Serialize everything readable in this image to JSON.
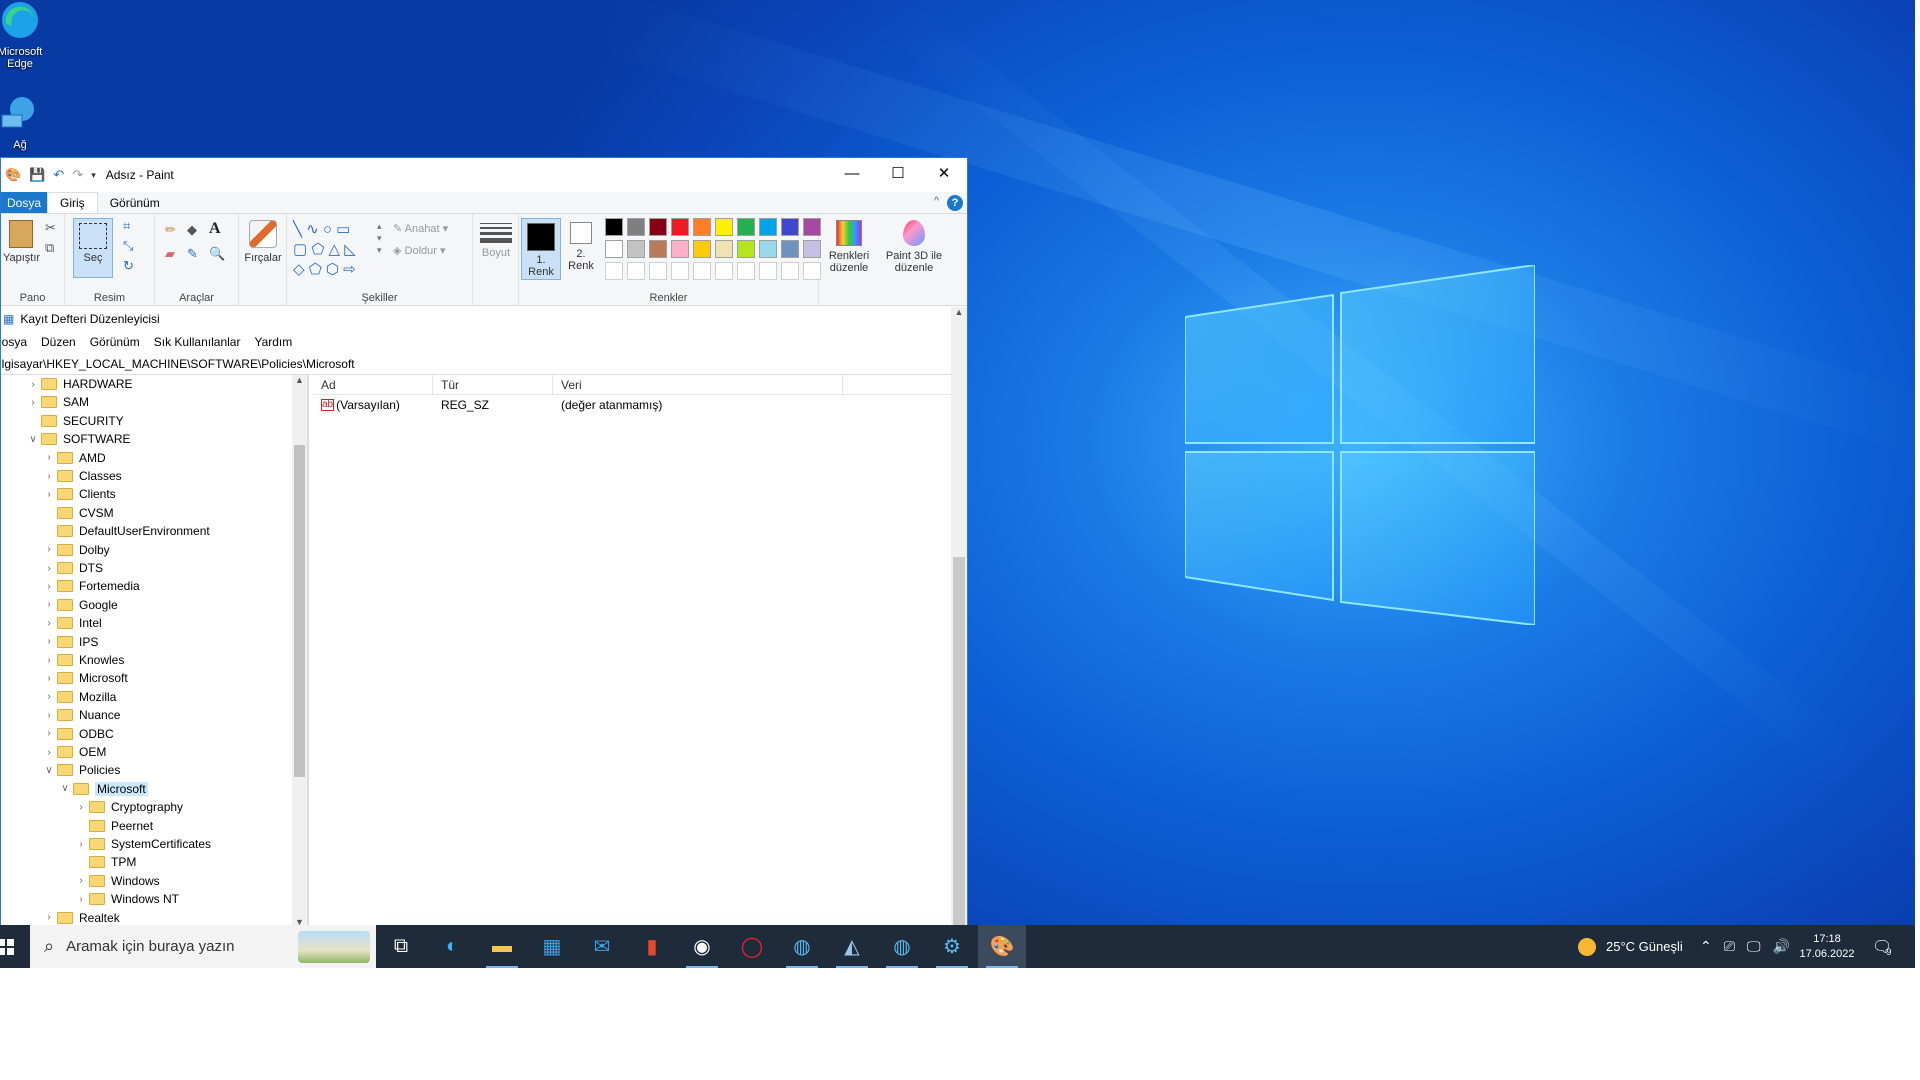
{
  "desktop": {
    "icons": [
      {
        "label": "Microsoft Edge"
      },
      {
        "label": "Ağ"
      }
    ]
  },
  "paint": {
    "title": "Adsız - Paint",
    "tabs": {
      "file": "Dosya",
      "home": "Giriş",
      "view": "Görünüm"
    },
    "groups": {
      "clipboard": "Pano",
      "image": "Resim",
      "tools": "Araçlar",
      "shapes": "Şekiller",
      "colors": "Renkler"
    },
    "buttons": {
      "paste": "Yapıştır",
      "select": "Seç",
      "brushes": "Fırçalar",
      "outline": "Anahat",
      "fill": "Doldur",
      "size": "Boyut",
      "color1_line1": "1.",
      "color1_line2": "Renk",
      "color2_line1": "2.",
      "color2_line2": "Renk",
      "edit_colors_line1": "Renkleri",
      "edit_colors_line2": "düzenle",
      "paint3d_line1": "Paint 3D ile",
      "paint3d_line2": "düzenle"
    },
    "palette_row1": [
      "#000000",
      "#7f7f7f",
      "#880015",
      "#ed1c24",
      "#ff7f27",
      "#fff200",
      "#22b14c",
      "#00a2e8",
      "#3f48cc",
      "#a349a4"
    ],
    "palette_row2": [
      "#ffffff",
      "#c3c3c3",
      "#b97a57",
      "#ffaec9",
      "#ffc90e",
      "#efe4b0",
      "#b5e61d",
      "#99d9ea",
      "#7092be",
      "#c8bfe7"
    ]
  },
  "regedit": {
    "title": "Kayıt Defteri Düzenleyicisi",
    "menu": [
      "Dosya",
      "Düzen",
      "Görünüm",
      "Sık Kullanılanlar",
      "Yardım"
    ],
    "address": "Bilgisayar\\HKEY_LOCAL_MACHINE\\SOFTWARE\\Policies\\Microsoft",
    "tree": [
      {
        "label": "HARDWARE",
        "depth": 0,
        "expanded": false
      },
      {
        "label": "SAM",
        "depth": 0,
        "expanded": false
      },
      {
        "label": "SECURITY",
        "depth": 0,
        "expanded": null
      },
      {
        "label": "SOFTWARE",
        "depth": 0,
        "expanded": true
      },
      {
        "label": "AMD",
        "depth": 1,
        "expanded": false
      },
      {
        "label": "Classes",
        "depth": 1,
        "expanded": false
      },
      {
        "label": "Clients",
        "depth": 1,
        "expanded": false
      },
      {
        "label": "CVSM",
        "depth": 1,
        "expanded": null
      },
      {
        "label": "DefaultUserEnvironment",
        "depth": 1,
        "expanded": null
      },
      {
        "label": "Dolby",
        "depth": 1,
        "expanded": false
      },
      {
        "label": "DTS",
        "depth": 1,
        "expanded": false
      },
      {
        "label": "Fortemedia",
        "depth": 1,
        "expanded": false
      },
      {
        "label": "Google",
        "depth": 1,
        "expanded": false
      },
      {
        "label": "Intel",
        "depth": 1,
        "expanded": false
      },
      {
        "label": "IPS",
        "depth": 1,
        "expanded": false
      },
      {
        "label": "Knowles",
        "depth": 1,
        "expanded": false
      },
      {
        "label": "Microsoft",
        "depth": 1,
        "expanded": false
      },
      {
        "label": "Mozilla",
        "depth": 1,
        "expanded": false
      },
      {
        "label": "Nuance",
        "depth": 1,
        "expanded": false
      },
      {
        "label": "ODBC",
        "depth": 1,
        "expanded": false
      },
      {
        "label": "OEM",
        "depth": 1,
        "expanded": false
      },
      {
        "label": "Policies",
        "depth": 1,
        "expanded": true
      },
      {
        "label": "Microsoft",
        "depth": 2,
        "expanded": true,
        "selected": true
      },
      {
        "label": "Cryptography",
        "depth": 3,
        "expanded": false
      },
      {
        "label": "Peernet",
        "depth": 3,
        "expanded": null
      },
      {
        "label": "SystemCertificates",
        "depth": 3,
        "expanded": false
      },
      {
        "label": "TPM",
        "depth": 3,
        "expanded": null
      },
      {
        "label": "Windows",
        "depth": 3,
        "expanded": false
      },
      {
        "label": "Windows NT",
        "depth": 3,
        "expanded": false
      },
      {
        "label": "Realtek",
        "depth": 1,
        "expanded": false
      }
    ],
    "columns": [
      "Ad",
      "Tür",
      "Veri"
    ],
    "rows": [
      {
        "name": "(Varsayılan)",
        "type": "REG_SZ",
        "data": "(değer atanmamış)"
      }
    ]
  },
  "taskbar": {
    "search_placeholder": "Aramak için buraya yazın",
    "weather": "25°C  Güneşli",
    "time": "17:18",
    "date": "17.06.2022",
    "notification_count": "9"
  }
}
